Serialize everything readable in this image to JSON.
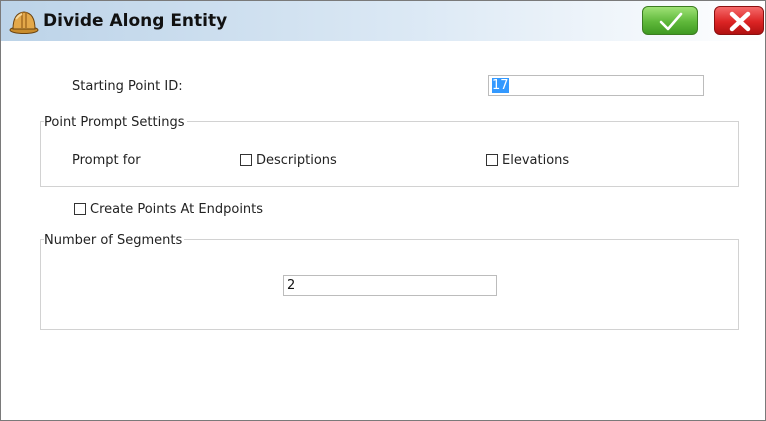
{
  "window": {
    "title": "Divide Along Entity"
  },
  "header": {
    "app_icon": "hardhat-icon",
    "ok_icon": "checkmark-icon",
    "cancel_icon": "x-icon",
    "ok_color": "#5fb83a",
    "cancel_color": "#dc2424"
  },
  "form": {
    "starting_point_label": "Starting Point ID:",
    "starting_point_value": "17",
    "prompt_settings_legend": "Point Prompt Settings",
    "prompt_for_label": "Prompt for",
    "descriptions_label": "Descriptions",
    "descriptions_checked": false,
    "elevations_label": "Elevations",
    "elevations_checked": false,
    "create_endpoints_label": "Create Points At Endpoints",
    "create_endpoints_checked": false,
    "segments_legend": "Number of Segments",
    "segments_value": "2"
  }
}
